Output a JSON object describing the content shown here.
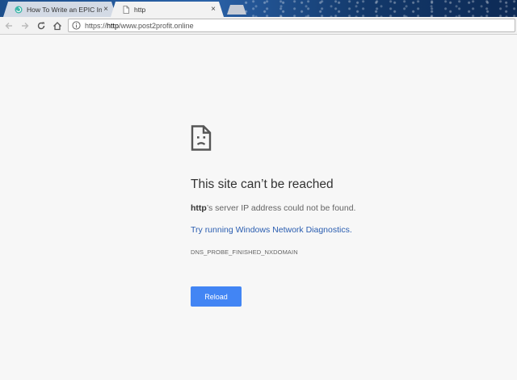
{
  "tabs": [
    {
      "title": "How To Write an EPIC Int",
      "close": "×",
      "active": false
    },
    {
      "title": "http",
      "close": "×",
      "active": true
    }
  ],
  "toolbar": {
    "url_scheme": "https://",
    "url_host": "http",
    "url_rest": "/www.post2profit.online"
  },
  "error": {
    "title": "This site can’t be reached",
    "host_bold": "http",
    "desc_rest": "’s server IP address could not be found.",
    "diagnostics_link": "Try running Windows Network Diagnostics.",
    "error_code": "DNS_PROBE_FINISHED_NXDOMAIN",
    "reload_label": "Reload"
  },
  "colors": {
    "accent_button": "#4285f4",
    "link": "#2a5db0",
    "page_bg": "#f7f7f7"
  },
  "icons": {
    "tab1_favicon": "spiral-favicon-icon",
    "tab2_favicon": "document-icon",
    "back": "back-arrow-icon",
    "forward": "forward-arrow-icon",
    "reload": "reload-icon",
    "home": "home-icon",
    "site_info": "info-icon",
    "error_graphic": "sad-page-icon"
  }
}
